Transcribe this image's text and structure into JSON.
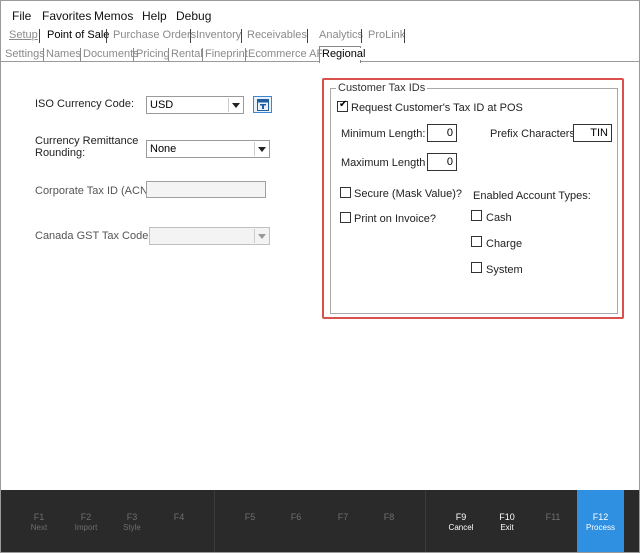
{
  "menu": [
    "File",
    "Favorites",
    "Memos",
    "Help",
    "Debug"
  ],
  "tabs_top": [
    "Setup",
    "Point of Sale",
    "Purchase Orders",
    "Inventory",
    "Receivables",
    "Analytics",
    "ProLink"
  ],
  "tabs_sub": [
    "Settings",
    "Names",
    "Documents",
    "Pricing",
    "Rental",
    "Fineprint",
    "Ecommerce API",
    "Regional"
  ],
  "regional": {
    "iso_currency_label": "ISO Currency Code:",
    "iso_currency_value": "USD",
    "remittance_label_1": "Currency Remittance",
    "remittance_label_2": "Rounding:",
    "remittance_value": "None",
    "corp_tax_label": "Corporate Tax ID (ACN):",
    "corp_tax_value": "",
    "gst_label": "Canada GST Tax Code:",
    "gst_value": ""
  },
  "customer_tax": {
    "title": "Customer Tax IDs",
    "request_label": "Request Customer's Tax ID at POS",
    "request_checked": true,
    "min_length_label": "Minimum Length:",
    "min_length_value": "0",
    "max_length_label": "Maximum Length",
    "max_length_value": "0",
    "prefix_label": "Prefix Characters:",
    "prefix_value": "TIN",
    "secure_label": "Secure (Mask Value)?",
    "print_label": "Print on Invoice?",
    "enabled_types_label": "Enabled Account Types:",
    "types": [
      "Cash",
      "Charge",
      "System"
    ]
  },
  "footer": {
    "f1": {
      "key": "F1",
      "name": "Next"
    },
    "f2": {
      "key": "F2",
      "name": "Import"
    },
    "f3": {
      "key": "F3",
      "name": "Style"
    },
    "f4": {
      "key": "F4",
      "name": ""
    },
    "f5": {
      "key": "F5",
      "name": ""
    },
    "f6": {
      "key": "F6",
      "name": ""
    },
    "f7": {
      "key": "F7",
      "name": ""
    },
    "f8": {
      "key": "F8",
      "name": ""
    },
    "f9": {
      "key": "F9",
      "name": "Cancel"
    },
    "f10": {
      "key": "F10",
      "name": "Exit"
    },
    "f11": {
      "key": "F11",
      "name": ""
    },
    "f12": {
      "key": "F12",
      "name": "Process"
    }
  },
  "colors": {
    "highlight": "#d9504d",
    "primary": "#2f8fe0",
    "footer_bg": "#2a2a2a"
  }
}
